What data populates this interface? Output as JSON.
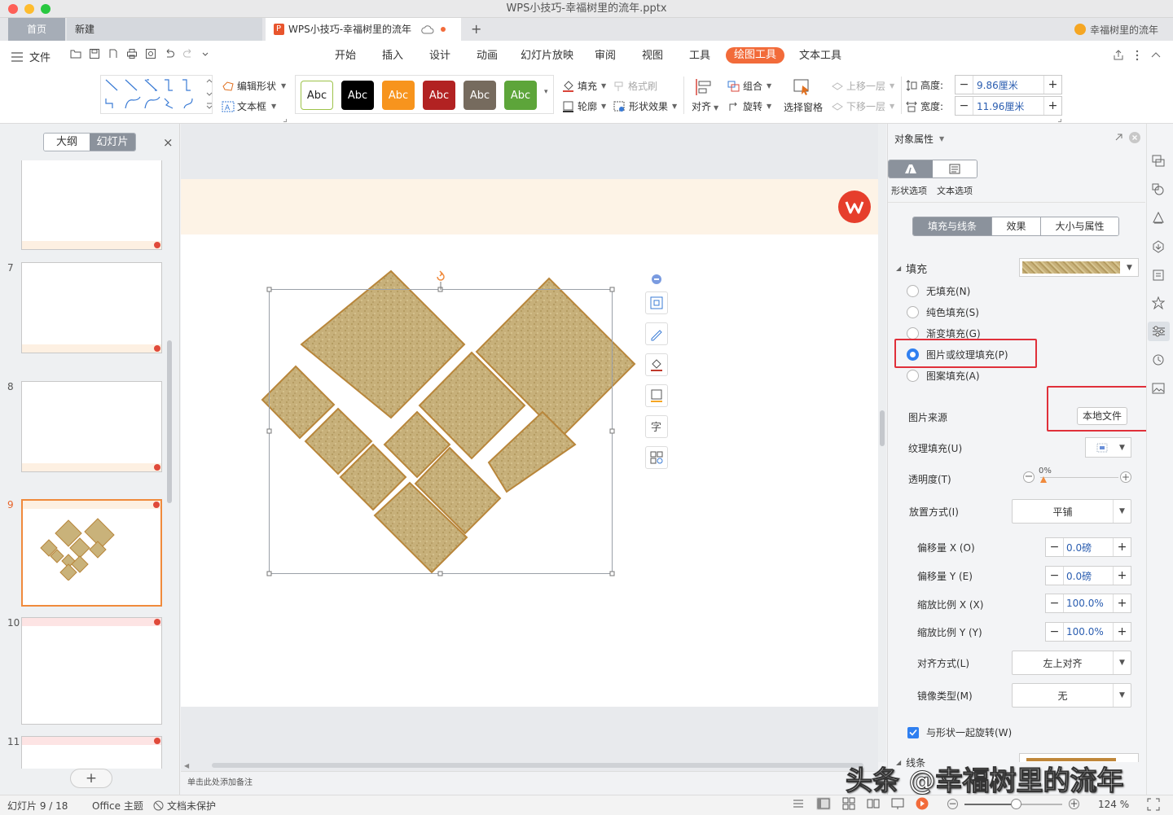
{
  "window": {
    "title": "WPS小技巧-幸福树里的流年.pptx"
  },
  "tabs": {
    "home": "首页",
    "new": "新建",
    "doc": "WPS小技巧-幸福树里的流年",
    "add": "+"
  },
  "user": {
    "name": "幸福树里的流年"
  },
  "menu": {
    "file": "文件",
    "ribbon_tabs": [
      "开始",
      "插入",
      "设计",
      "动画",
      "幻灯片放映",
      "审阅",
      "视图",
      "工具",
      "绘图工具",
      "文本工具"
    ],
    "active_tab": "绘图工具"
  },
  "ribbon": {
    "edit_shape": "编辑形状",
    "text_box": "文本框",
    "style_label": "Abc",
    "styles": [
      {
        "bg": "#ffffff",
        "fg": "#222222",
        "border": "#9dc34a"
      },
      {
        "bg": "#000000",
        "fg": "#ffffff",
        "border": "#000000"
      },
      {
        "bg": "#f7941d",
        "fg": "#ffffff",
        "border": "#f7941d"
      },
      {
        "bg": "#b22222",
        "fg": "#ffffff",
        "border": "#b22222"
      },
      {
        "bg": "#766b5e",
        "fg": "#ffffff",
        "border": "#766b5e"
      },
      {
        "bg": "#5da53a",
        "fg": "#ffffff",
        "border": "#5da53a"
      }
    ],
    "fill": "填充",
    "format_painter": "格式刷",
    "outline": "轮廓",
    "shape_effects": "形状效果",
    "align": "对齐",
    "group": "组合",
    "rotate": "旋转",
    "selection_pane": "选择窗格",
    "bring_forward": "上移一层",
    "send_backward": "下移一层",
    "height_label": "高度:",
    "height_value": "9.86厘米",
    "width_label": "宽度:",
    "width_value": "11.96厘米"
  },
  "left_panel": {
    "tab_outline": "大纲",
    "tab_slides": "幻灯片",
    "close": "×",
    "slide_numbers": [
      "7",
      "8",
      "9",
      "10",
      "11"
    ],
    "active_slide": "9",
    "add": "+"
  },
  "canvas": {
    "notes_placeholder": "单击此处添加备注"
  },
  "properties": {
    "title": "对象属性",
    "shape_options": "形状选项",
    "text_options": "文本选项",
    "subtabs": [
      "填充与线条",
      "效果",
      "大小与属性"
    ],
    "fill_section": "填充",
    "fill_options": [
      "无填充(N)",
      "纯色填充(S)",
      "渐变填充(G)",
      "图片或纹理填充(P)",
      "图案填充(A)"
    ],
    "selected_fill": "图片或纹理填充(P)",
    "picture_source_label": "图片来源",
    "local_file_button": "本地文件",
    "texture_fill_label": "纹理填充(U)",
    "transparency_label": "透明度(T)",
    "transparency_value": "0%",
    "placement_label": "放置方式(I)",
    "placement_value": "平铺",
    "offset_x_label": "偏移量 X (O)",
    "offset_x_value": "0.0磅",
    "offset_y_label": "偏移量 Y (E)",
    "offset_y_value": "0.0磅",
    "scale_x_label": "缩放比例 X (X)",
    "scale_x_value": "100.0%",
    "scale_y_label": "缩放比例 Y (Y)",
    "scale_y_value": "100.0%",
    "alignment_label": "对齐方式(L)",
    "alignment_value": "左上对齐",
    "mirror_label": "镜像类型(M)",
    "mirror_value": "无",
    "rotate_with_shape": "与形状一起旋转(W)",
    "rotate_with_shape_checked": true,
    "line_section": "线条"
  },
  "status": {
    "slide_info": "幻灯片 9 / 18",
    "theme": "Office 主题",
    "protection": "文档未保护",
    "zoom": "124 %"
  },
  "watermark": "头条 @幸福树里的流年",
  "colors": {
    "accent": "#f26b3a",
    "highlight_box": "#e0303a",
    "texture": "#c9b27a",
    "texture_border": "#b8863b"
  }
}
